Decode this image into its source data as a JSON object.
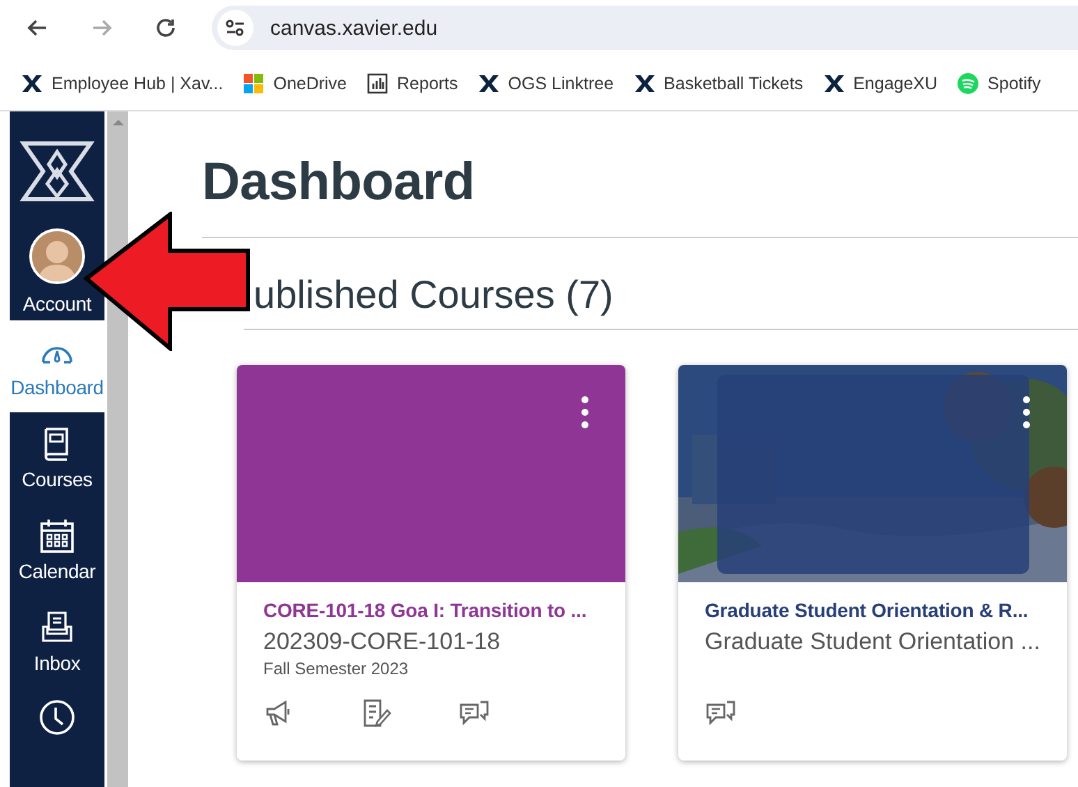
{
  "browser": {
    "url": "canvas.xavier.edu"
  },
  "bookmarks": [
    {
      "label": "Employee Hub | Xav...",
      "kind": "x"
    },
    {
      "label": "OneDrive",
      "kind": "windows"
    },
    {
      "label": "Reports",
      "kind": "chart"
    },
    {
      "label": "OGS Linktree",
      "kind": "x"
    },
    {
      "label": "Basketball Tickets",
      "kind": "x"
    },
    {
      "label": "EngageXU",
      "kind": "x"
    },
    {
      "label": "Spotify",
      "kind": "spotify"
    }
  ],
  "nav": [
    {
      "kind": "account",
      "label": "Account",
      "selected": false
    },
    {
      "kind": "dashboard",
      "label": "Dashboard",
      "selected": true
    },
    {
      "kind": "courses",
      "label": "Courses",
      "selected": false
    },
    {
      "kind": "calendar",
      "label": "Calendar",
      "selected": false
    },
    {
      "kind": "inbox",
      "label": "Inbox",
      "selected": false
    },
    {
      "kind": "history",
      "selected": false
    }
  ],
  "page": {
    "title": "Dashboard",
    "section": "ublished Courses (7)"
  },
  "cards": [
    {
      "kind": "color",
      "color": "#8f3596",
      "title": "CORE-101-18 Goa I: Transition to ...",
      "code": "202309-CORE-101-18",
      "term": "Fall Semester 2023",
      "actions": [
        {
          "kind": "announcements"
        },
        {
          "kind": "assignments"
        },
        {
          "kind": "discussions"
        }
      ]
    },
    {
      "kind": "picture",
      "color": "#273f78",
      "title": "Graduate Student Orientation & R...",
      "code": "Graduate Student Orientation ...",
      "actions": [
        {
          "kind": "discussions"
        }
      ]
    }
  ],
  "annotation": {
    "kind": "arrow",
    "color": "#ed1c24"
  }
}
